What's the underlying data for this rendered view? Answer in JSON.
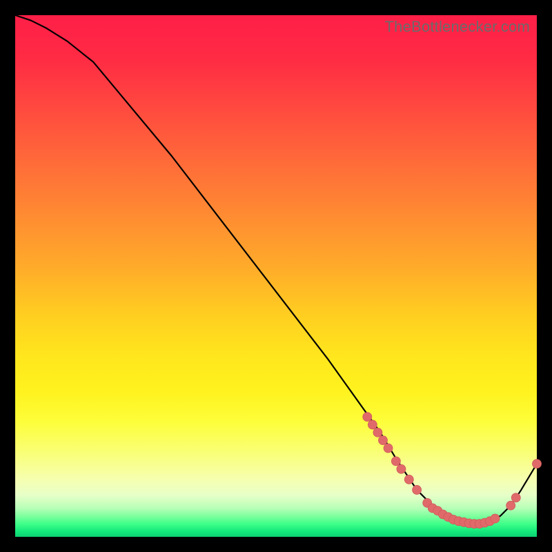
{
  "watermark": "TheBottlenecker.com",
  "colors": {
    "curve_stroke": "#000000",
    "marker_fill": "#e06a6a",
    "marker_stroke": "#cf5a5a"
  },
  "chart_data": {
    "type": "line",
    "title": "",
    "xlabel": "",
    "ylabel": "",
    "xlim": [
      0,
      100
    ],
    "ylim": [
      0,
      100
    ],
    "x": [
      0,
      3,
      6,
      10,
      15,
      20,
      30,
      40,
      50,
      60,
      65,
      70,
      73,
      75,
      77,
      79,
      81,
      83,
      85,
      87,
      89,
      91,
      93,
      95,
      97,
      100
    ],
    "values": [
      100,
      99,
      97.5,
      95,
      91,
      85,
      73,
      60,
      47,
      34,
      27,
      20,
      15,
      12,
      9,
      7,
      5,
      4,
      3,
      2.5,
      2.5,
      3,
      4,
      6,
      9,
      14
    ],
    "markers": [
      {
        "x": 67.5,
        "y": 23
      },
      {
        "x": 68.5,
        "y": 21.5
      },
      {
        "x": 69.5,
        "y": 20
      },
      {
        "x": 70.5,
        "y": 18.5
      },
      {
        "x": 71.5,
        "y": 17
      },
      {
        "x": 73,
        "y": 14.5
      },
      {
        "x": 74,
        "y": 13
      },
      {
        "x": 75.5,
        "y": 11
      },
      {
        "x": 77,
        "y": 9
      },
      {
        "x": 79,
        "y": 6.5
      },
      {
        "x": 80,
        "y": 5.5
      },
      {
        "x": 81,
        "y": 5
      },
      {
        "x": 82,
        "y": 4.3
      },
      {
        "x": 83,
        "y": 3.8
      },
      {
        "x": 84,
        "y": 3.3
      },
      {
        "x": 85,
        "y": 3
      },
      {
        "x": 86,
        "y": 2.8
      },
      {
        "x": 87,
        "y": 2.6
      },
      {
        "x": 88,
        "y": 2.5
      },
      {
        "x": 89,
        "y": 2.5
      },
      {
        "x": 90,
        "y": 2.7
      },
      {
        "x": 91,
        "y": 3
      },
      {
        "x": 92,
        "y": 3.5
      },
      {
        "x": 95,
        "y": 6
      },
      {
        "x": 96,
        "y": 7.5
      },
      {
        "x": 100,
        "y": 14
      }
    ]
  }
}
